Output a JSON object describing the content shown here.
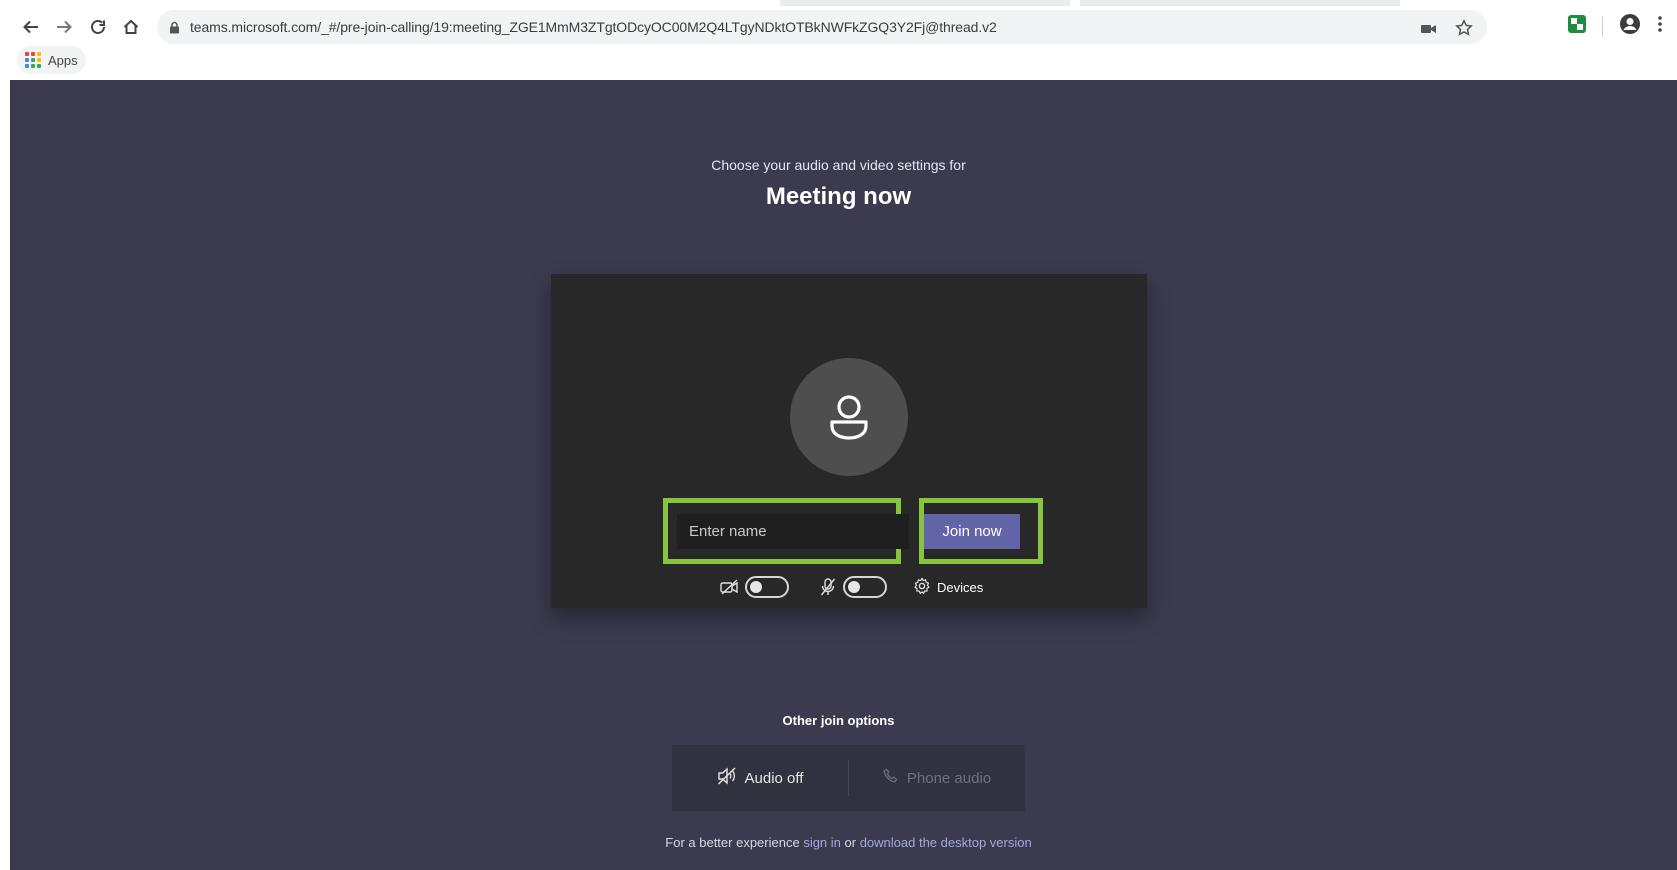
{
  "browser": {
    "url": "teams.microsoft.com/_#/pre-join-calling/19:meeting_ZGE1MmM3ZTgtODcyOC00M2Q4LTgyNDktOTBkNWFkZGQ3Y2Fj@thread.v2",
    "bookmarks": {
      "apps_label": "Apps"
    },
    "icons": [
      "back-icon",
      "forward-icon",
      "reload-icon",
      "home-icon",
      "lock-icon",
      "camera-blocked-icon",
      "star-icon",
      "extension-icon",
      "account-icon",
      "menu-icon"
    ]
  },
  "prejoin": {
    "subtitle": "Choose your audio and video settings for",
    "meeting_title": "Meeting now",
    "name_placeholder": "Enter name",
    "join_label": "Join now",
    "video_toggle": "off",
    "mic_toggle": "off",
    "devices_label": "Devices",
    "highlight_color": "#87c540",
    "accent_color": "#6264a7"
  },
  "other_options": {
    "title": "Other join options",
    "audio_off_label": "Audio off",
    "phone_audio_label": "Phone audio"
  },
  "footer": {
    "prefix": "For a better experience ",
    "sign_in": "sign in",
    "middle": " or ",
    "download": "download the desktop version"
  }
}
